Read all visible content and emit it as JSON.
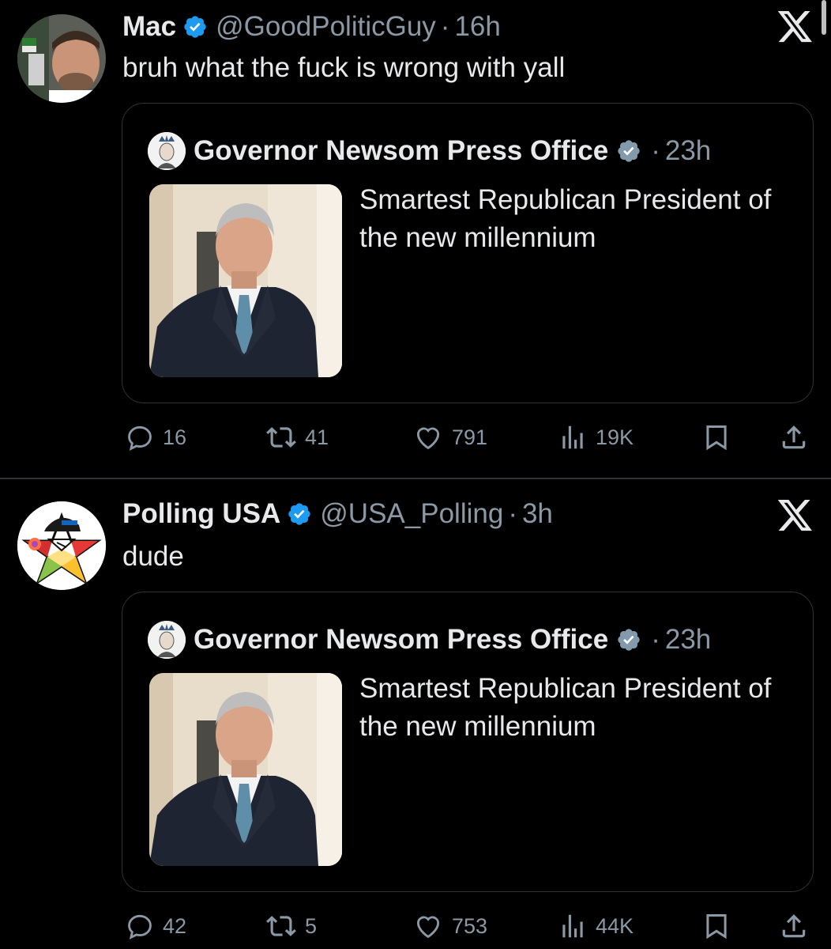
{
  "tweets": [
    {
      "name": "Mac",
      "handle": "@GoodPoliticGuy",
      "separator": "·",
      "time": "16h",
      "text": "bruh what the fuck is wrong with yall",
      "quote": {
        "name": "Governor Newsom Press Office",
        "separator": "·",
        "time": "23h",
        "text": "Smartest Republican President of the new millennium"
      },
      "stats": {
        "replies": "16",
        "reposts": "41",
        "likes": "791",
        "views": "19K"
      }
    },
    {
      "name": "Polling USA",
      "handle": "@USA_Polling",
      "separator": "·",
      "time": "3h",
      "text": "dude",
      "quote": {
        "name": "Governor Newsom Press Office",
        "separator": "·",
        "time": "23h",
        "text": "Smartest Republican President of the new millennium"
      },
      "stats": {
        "replies": "42",
        "reposts": "5",
        "likes": "753",
        "views": "44K"
      }
    }
  ],
  "colors": {
    "background": "#000000",
    "text_primary": "#e7e9ea",
    "text_secondary": "#8b98a5",
    "verified_badge": "#1d9bf0",
    "border": "#2f3336"
  },
  "icons": {
    "brand": "x-logo-icon",
    "verified": "verified-badge-icon",
    "reply": "reply-icon",
    "repost": "repost-icon",
    "like": "heart-icon",
    "views": "views-chart-icon",
    "bookmark": "bookmark-icon",
    "share": "share-icon"
  }
}
